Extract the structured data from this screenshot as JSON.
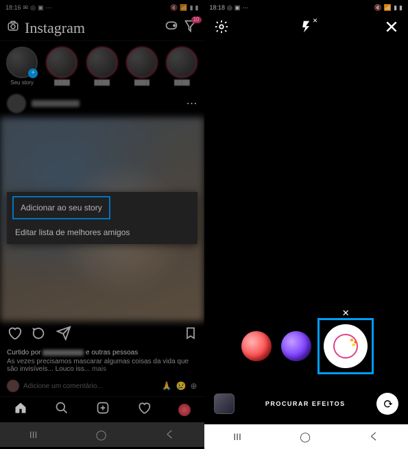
{
  "left": {
    "statusbar": {
      "time": "18:16"
    },
    "header": {
      "logo": "Instagram",
      "badge": "10"
    },
    "stories": {
      "self_label": "Seu story",
      "placeholders": [
        "",
        "",
        "",
        ""
      ]
    },
    "popup": {
      "add_to_story": "Adicionar ao seu story",
      "edit_close_friends": "Editar lista de melhores amigos"
    },
    "post": {
      "liked_prefix": "Curtido por",
      "liked_suffix": "e outras pessoas",
      "caption": "As vezes precisamos mascarar algumas coisas da vida que são invisíveis... Louco iss...",
      "more": "mais",
      "comment_placeholder": "Adicione um comentário..."
    }
  },
  "right": {
    "statusbar": {
      "time": "18:18"
    },
    "search_effects": "PROCURAR EFEITOS"
  }
}
